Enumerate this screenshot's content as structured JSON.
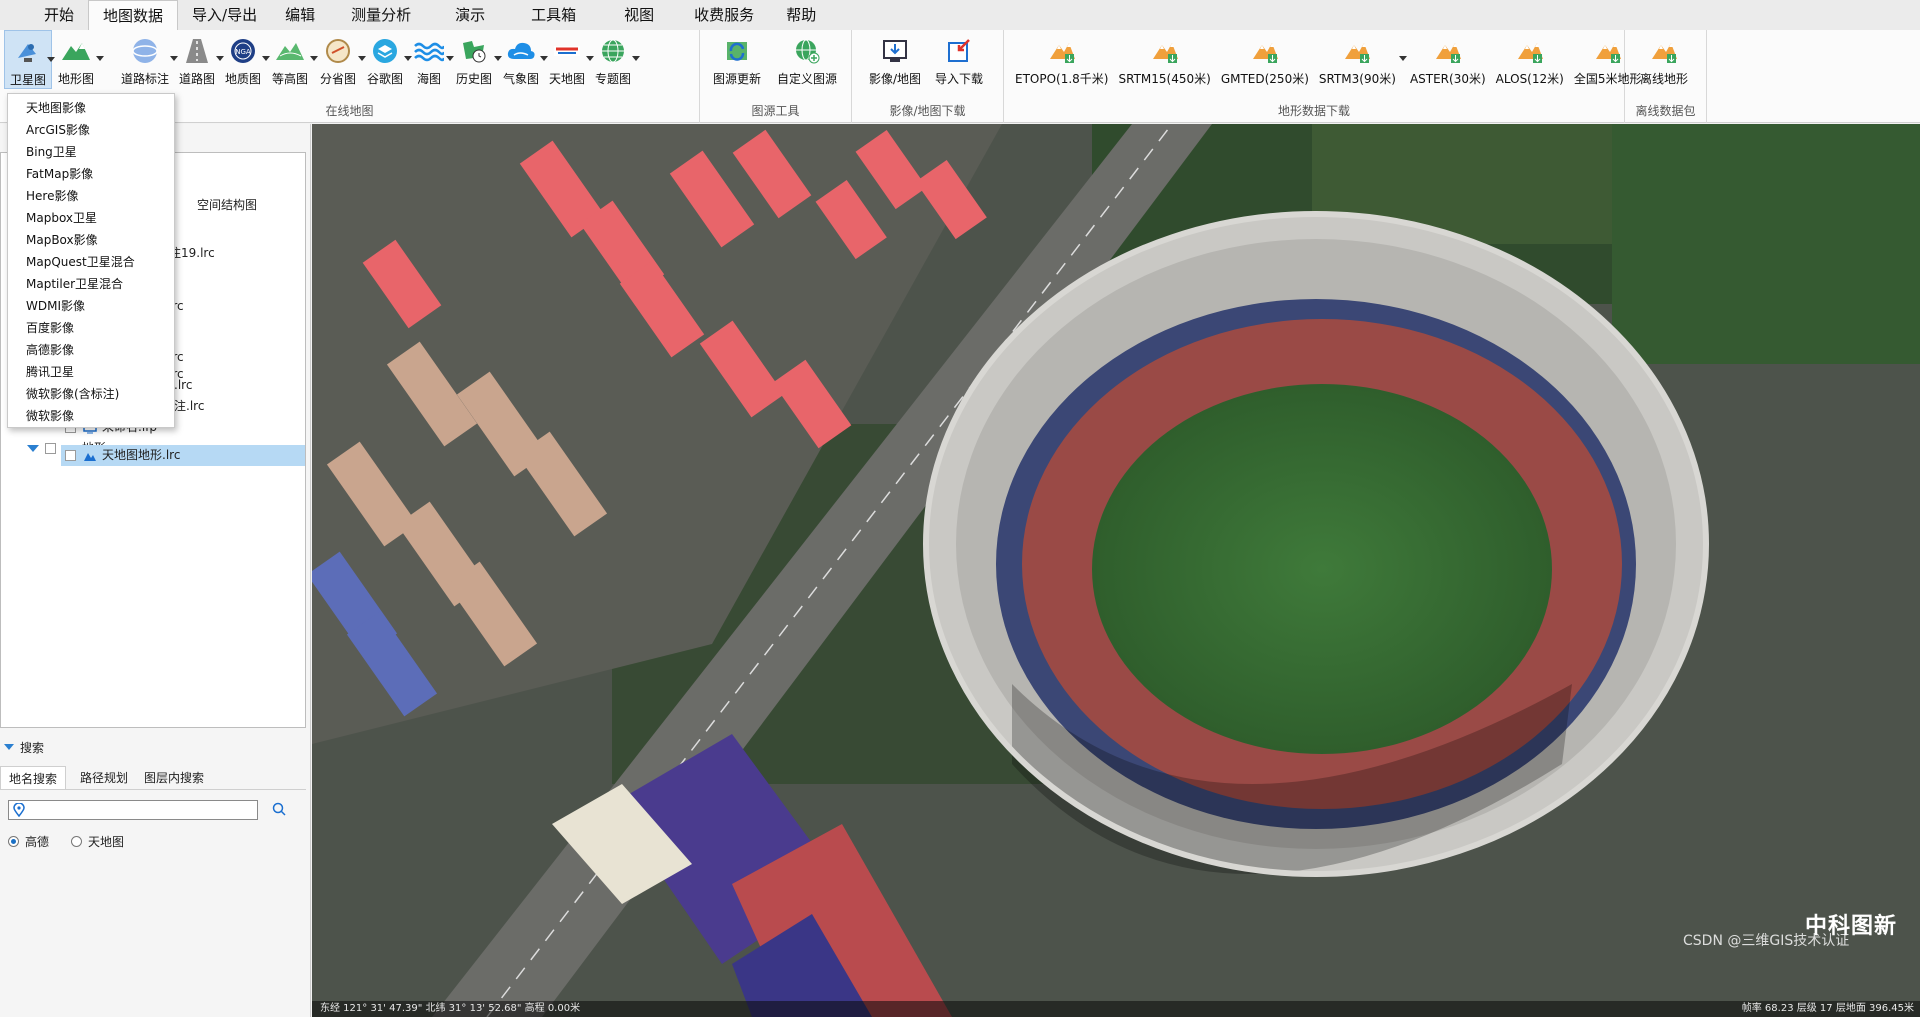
{
  "menu": {
    "tabs": [
      "开始",
      "地图数据",
      "导入/导出",
      "编辑",
      "测量分析",
      "演示",
      "工具箱",
      "视图",
      "收费服务",
      "帮助"
    ],
    "active_index": 1
  },
  "ribbon": {
    "online_map": {
      "label": "在线地图",
      "buttons": [
        "卫星图",
        "地形图",
        "道路标注",
        "道路图",
        "地质图",
        "等高图",
        "分省图",
        "谷歌图",
        "海图",
        "历史图",
        "气象图",
        "天地图",
        "专题图"
      ]
    },
    "source_tools": {
      "label": "图源工具",
      "buttons": [
        "图源更新",
        "自定义图源"
      ]
    },
    "image_download": {
      "label": "影像/地图下载",
      "buttons": [
        "影像/地图",
        "导入下载"
      ]
    },
    "terrain_download": {
      "label": "地形数据下载",
      "buttons": [
        "ETOPO(1.8千米)",
        "SRTM15(450米)",
        "GMTED(250米)",
        "SRTM3(90米)",
        "ASTER(30米)",
        "ALOS(12米)",
        "全国5米地形"
      ]
    },
    "offline_pack": {
      "label": "离线数据包",
      "buttons": [
        "离线地形"
      ]
    }
  },
  "dropdown": {
    "items": [
      "天地图影像",
      "ArcGIS影像",
      "Bing卫星",
      "FatMap影像",
      "Here影像",
      "Mapbox卫星",
      "MapBox影像",
      "MapQuest卫星混合",
      "Maptiler卫星混合",
      "WDMI影像",
      "百度影像",
      "高德影像",
      "腾讯卫星",
      "微软影像(含标注)",
      "微软影像"
    ]
  },
  "tree": {
    "partial": [
      "空间结构图",
      "注19.lrc",
      "c",
      "lrc",
      "c",
      "c",
      "lrc",
      "lrc"
    ],
    "items": [
      {
        "label": "高德道路标注.lrc"
      },
      {
        "label": "天地图道路标注.lrc"
      },
      {
        "label": "未命名.lfp"
      },
      {
        "label": "地形"
      },
      {
        "label": "天地图地形.lrc"
      }
    ]
  },
  "search": {
    "header": "搜索",
    "tabs": [
      "地名搜索",
      "路径规划",
      "图层内搜索"
    ],
    "input_value": "",
    "radios": [
      {
        "label": "高德",
        "checked": true
      },
      {
        "label": "天地图",
        "checked": false
      }
    ]
  },
  "statusbar": {
    "left": "东经 121°  31'  47.39\"  北纬 31°  13'  52.68\"  高程 0.00米",
    "right": "帧率 68.23  层级 17  层地面 396.45米"
  },
  "watermark": {
    "brand": "中科图新",
    "csdn": "CSDN @三维GIS技术认证"
  },
  "colors": {
    "accent": "#1a6fc4",
    "selection": "#b6d9f4",
    "roof_red": "#e8656a",
    "field_green": "#3f7a3a",
    "track_red": "#9a4a46"
  }
}
